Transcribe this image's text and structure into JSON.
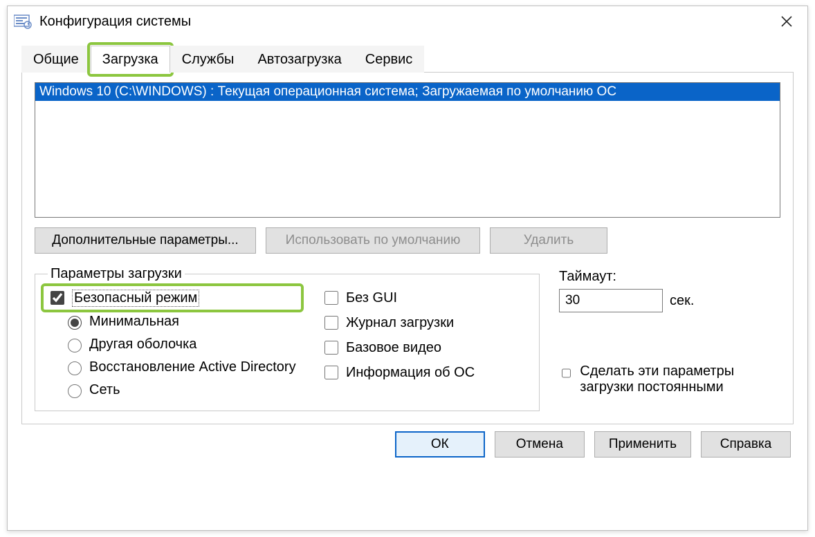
{
  "window": {
    "title": "Конфигурация системы"
  },
  "tabs": {
    "general": "Общие",
    "boot": "Загрузка",
    "services": "Службы",
    "startup": "Автозагрузка",
    "tools": "Сервис",
    "active": "boot"
  },
  "bootList": {
    "items": [
      "Windows 10 (C:\\WINDOWS) : Текущая операционная система; Загружаемая по умолчанию ОС"
    ],
    "selectedIndex": 0
  },
  "buttons": {
    "advanced": "Дополнительные параметры...",
    "setDefault": "Использовать по умолчанию",
    "delete": "Удалить"
  },
  "bootOptions": {
    "legend": "Параметры загрузки",
    "safeMode": {
      "label": "Безопасный режим",
      "checked": true
    },
    "radios": {
      "minimal": "Минимальная",
      "altShell": "Другая оболочка",
      "adRepair": "Восстановление Active Directory",
      "network": "Сеть",
      "selected": "minimal"
    },
    "noGui": {
      "label": "Без GUI",
      "checked": false
    },
    "bootLog": {
      "label": "Журнал загрузки",
      "checked": false
    },
    "baseVideo": {
      "label": "Базовое видео",
      "checked": false
    },
    "osInfo": {
      "label": "Информация  об ОС",
      "checked": false
    }
  },
  "timeout": {
    "label": "Таймаут:",
    "value": "30",
    "unit": "сек."
  },
  "persist": {
    "label": "Сделать эти параметры загрузки постоянными",
    "checked": false
  },
  "footer": {
    "ok": "ОК",
    "cancel": "Отмена",
    "apply": "Применить",
    "help": "Справка"
  }
}
